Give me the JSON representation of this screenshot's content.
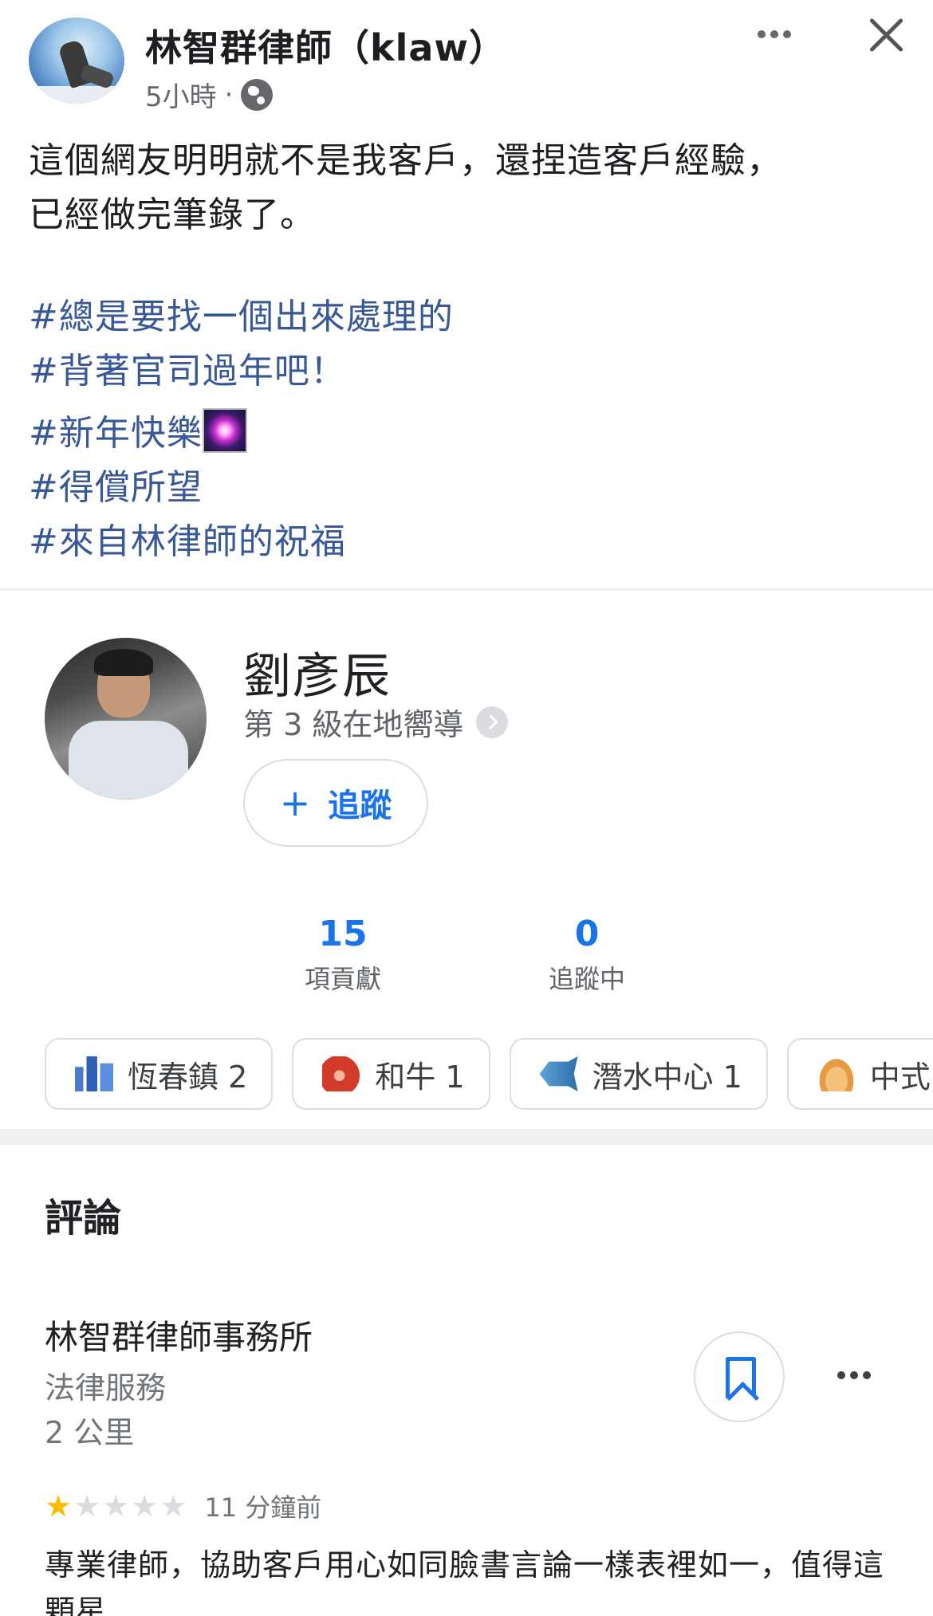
{
  "post": {
    "author": "林智群律師（klaw）",
    "time": "5小時",
    "separator": "·",
    "privacy_icon": "globe-icon",
    "text_line1": "這個網友明明就不是我客戶，還捏造客戶經驗，",
    "text_line2": "已經做完筆錄了。",
    "hashtags": [
      "#總是要找一個出來處理的",
      "#背著官司過年吧！",
      "#新年快樂",
      "#得償所望",
      "#來自林律師的祝福"
    ]
  },
  "profile": {
    "name": "劉彥辰",
    "level": "第 3 級在地嚮導",
    "follow_label": "追蹤",
    "follow_icon": "plus-icon",
    "stats": [
      {
        "value": "15",
        "label": "項貢獻"
      },
      {
        "value": "0",
        "label": "追蹤中"
      }
    ],
    "chips": [
      {
        "icon": "city-icon",
        "label": "恆春鎮 2"
      },
      {
        "icon": "meat-icon",
        "label": "和牛 1"
      },
      {
        "icon": "fish-icon",
        "label": "潛水中心 1"
      },
      {
        "icon": "noodle-icon",
        "label": "中式"
      }
    ]
  },
  "reviews": {
    "title": "評論",
    "business_name": "林智群律師事務所",
    "category": "法律服務",
    "distance": "2 公里",
    "rating": 1,
    "rating_max": 5,
    "time_ago": "11 分鐘前",
    "text": "專業律師，協助客戶用心如同臉書言論一樣表裡如一，值得這顆星"
  },
  "colors": {
    "hashtag": "#385898",
    "google_blue": "#1a73e8",
    "star": "#fbbc04"
  }
}
